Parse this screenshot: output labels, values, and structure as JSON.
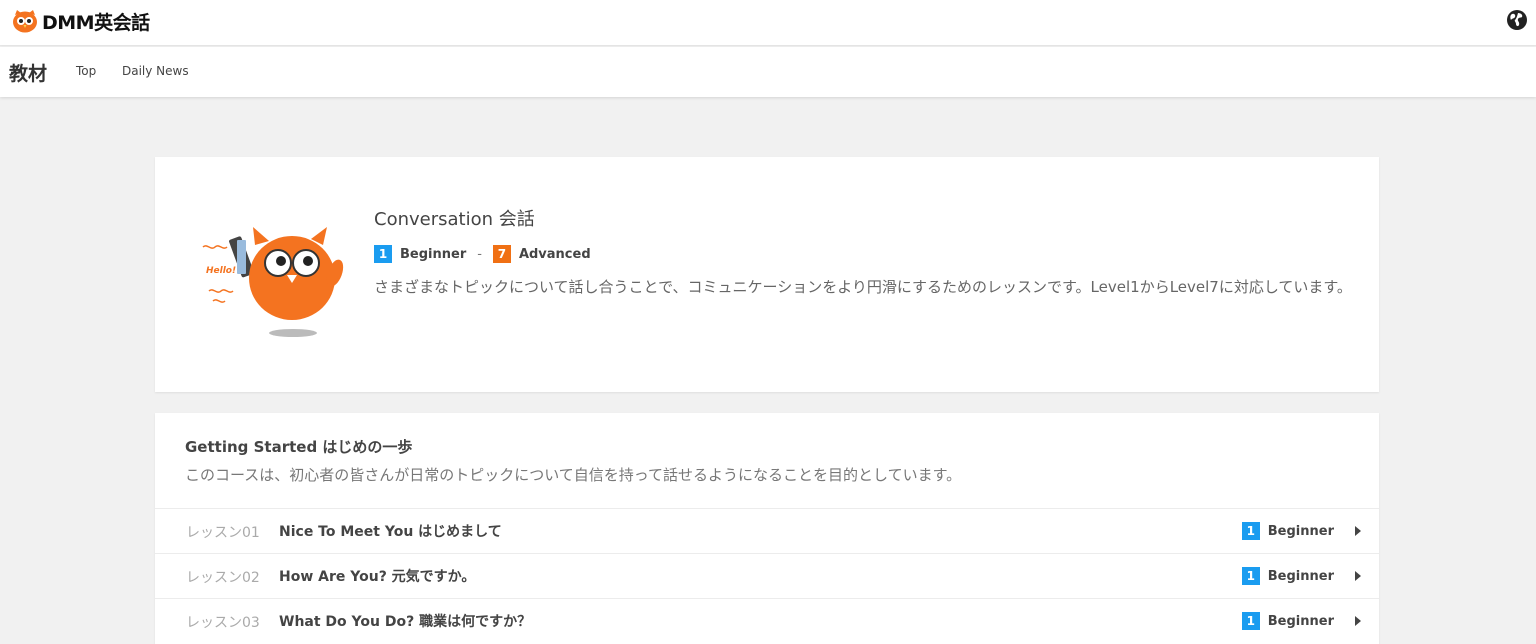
{
  "header": {
    "logo_text": "DMM英会話",
    "globe_icon": "globe-icon"
  },
  "subnav": {
    "title": "教材",
    "links": [
      "Top",
      "Daily News"
    ]
  },
  "course": {
    "illustration_text": "Hello!",
    "title": "Conversation 会話",
    "level_start": {
      "num": "1",
      "label": "Beginner",
      "color": "#1a9cf0"
    },
    "level_sep": "-",
    "level_end": {
      "num": "7",
      "label": "Advanced",
      "color": "#f07014"
    },
    "description": "さまざまなトピックについて話し合うことで、コミュニケーションをより円滑にするためのレッスンです。Level1からLevel7に対応しています。"
  },
  "section": {
    "title": "Getting Started はじめの一歩",
    "description": "このコースは、初心者の皆さんが日常のトピックについて自信を持って話せるようになることを目的としています。",
    "lessons": [
      {
        "num": "レッスン01",
        "title": "Nice To Meet You はじめまして",
        "level": "1",
        "level_label": "Beginner"
      },
      {
        "num": "レッスン02",
        "title": "How Are You? 元気ですか。",
        "level": "1",
        "level_label": "Beginner"
      },
      {
        "num": "レッスン03",
        "title": "What Do You Do? 職業は何ですか？",
        "level": "1",
        "level_label": "Beginner"
      }
    ]
  }
}
